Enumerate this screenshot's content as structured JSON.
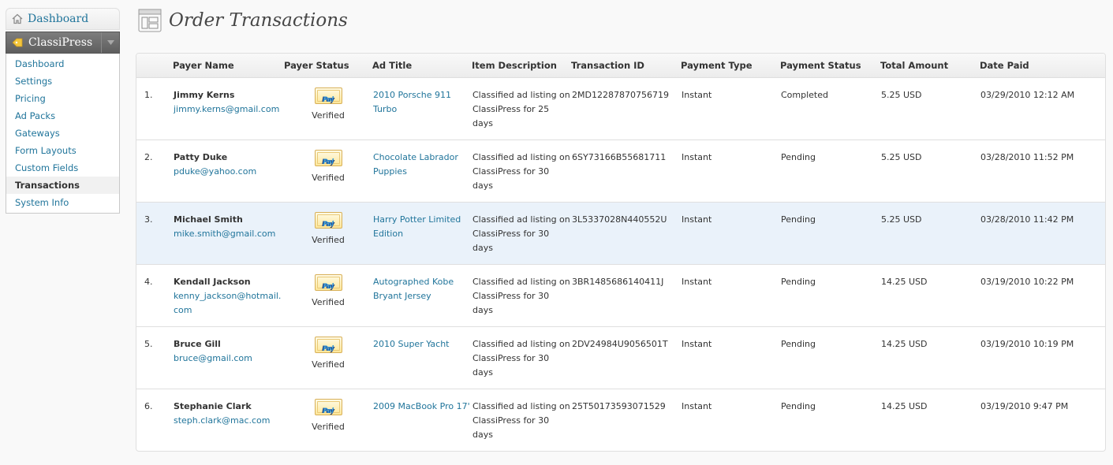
{
  "sidebar": {
    "dashboard": "Dashboard",
    "classipress": "ClassiPress",
    "items": [
      {
        "label": "Dashboard",
        "current": false
      },
      {
        "label": "Settings",
        "current": false
      },
      {
        "label": "Pricing",
        "current": false
      },
      {
        "label": "Ad Packs",
        "current": false
      },
      {
        "label": "Gateways",
        "current": false
      },
      {
        "label": "Form Layouts",
        "current": false
      },
      {
        "label": "Custom Fields",
        "current": false
      },
      {
        "label": "Transactions",
        "current": true
      },
      {
        "label": "System Info",
        "current": false
      }
    ]
  },
  "header": {
    "title": "Order Transactions"
  },
  "table": {
    "columns": [
      "",
      "Payer Name",
      "Payer Status",
      "Ad Title",
      "Item Description",
      "Transaction ID",
      "Payment Type",
      "Payment Status",
      "Total Amount",
      "Date Paid"
    ],
    "badge": {
      "pay": "Pay",
      "pal": "Pal"
    },
    "rows": [
      {
        "num": "1.",
        "name": "Jimmy Kerns",
        "email": "jimmy.kerns@gmail.com",
        "status": "Verified",
        "ad_title": "2010 Porsche 911 Turbo",
        "description": "Classified ad listing on ClassiPress for 25 days",
        "txn_id": "2MD12287870756719",
        "payment_type": "Instant",
        "payment_status": "Completed",
        "amount": "5.25 USD",
        "date": "03/29/2010 12:12 AM"
      },
      {
        "num": "2.",
        "name": "Patty Duke",
        "email": "pduke@yahoo.com",
        "status": "Verified",
        "ad_title": "Chocolate Labrador Puppies",
        "description": "Classified ad listing on ClassiPress for 30 days",
        "txn_id": "6SY73166B55681711",
        "payment_type": "Instant",
        "payment_status": "Pending",
        "amount": "5.25 USD",
        "date": "03/28/2010 11:52 PM"
      },
      {
        "num": "3.",
        "name": "Michael Smith",
        "email": "mike.smith@gmail.com",
        "status": "Verified",
        "ad_title": "Harry Potter Limited Edition",
        "description": "Classified ad listing on ClassiPress for 30 days",
        "txn_id": "3L5337028N440552U",
        "payment_type": "Instant",
        "payment_status": "Pending",
        "amount": "5.25 USD",
        "date": "03/28/2010 11:42 PM"
      },
      {
        "num": "4.",
        "name": "Kendall Jackson",
        "email": "kenny_jackson@hotmail.com",
        "status": "Verified",
        "ad_title": "Autographed Kobe Bryant Jersey",
        "description": "Classified ad listing on ClassiPress for 30 days",
        "txn_id": "3BR1485686140411J",
        "payment_type": "Instant",
        "payment_status": "Pending",
        "amount": "14.25 USD",
        "date": "03/19/2010 10:22 PM"
      },
      {
        "num": "5.",
        "name": "Bruce Gill",
        "email": "bruce@gmail.com",
        "status": "Verified",
        "ad_title": "2010 Super Yacht",
        "description": "Classified ad listing on ClassiPress for 30 days",
        "txn_id": "2DV24984U9056501T",
        "payment_type": "Instant",
        "payment_status": "Pending",
        "amount": "14.25 USD",
        "date": "03/19/2010 10:19 PM"
      },
      {
        "num": "6.",
        "name": "Stephanie Clark",
        "email": "steph.clark@mac.com",
        "status": "Verified",
        "ad_title": "2009 MacBook Pro 17'",
        "description": "Classified ad listing on ClassiPress for 30 days",
        "txn_id": "25T50173593071529",
        "payment_type": "Instant",
        "payment_status": "Pending",
        "amount": "14.25 USD",
        "date": "03/19/2010 9:47 PM"
      }
    ]
  }
}
